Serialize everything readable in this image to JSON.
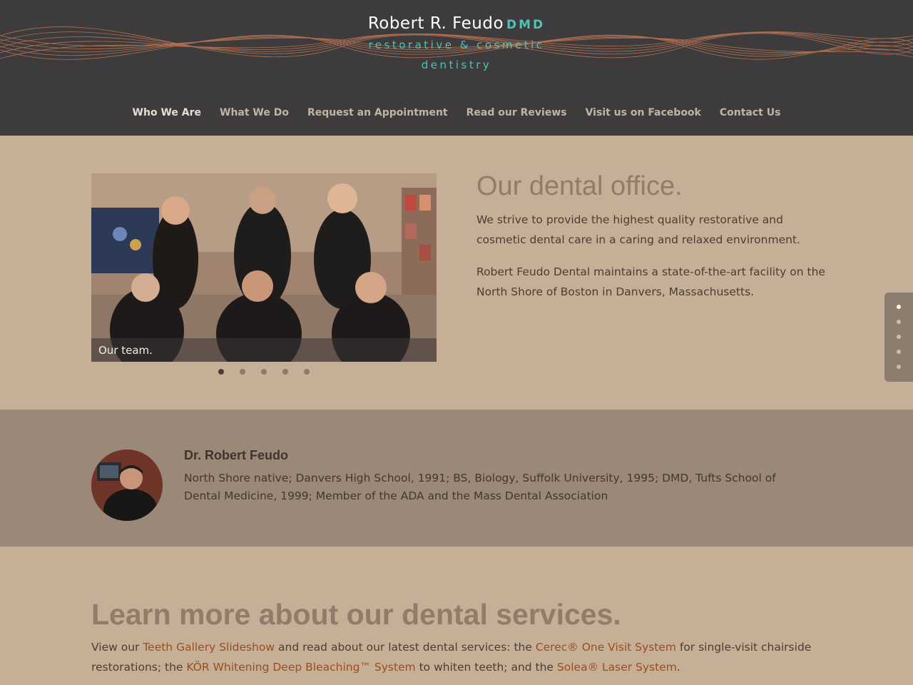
{
  "brand": {
    "name": "Robert R. Feudo",
    "suffix": "DMD",
    "tagline1": "restorative & cosmetic",
    "tagline2": "dentistry",
    "accent": "#4fc3b6",
    "header_bg": "#3d3b3b"
  },
  "nav": {
    "items": [
      {
        "label": "Who We Are",
        "active": true
      },
      {
        "label": "What We Do"
      },
      {
        "label": "Request an Appointment"
      },
      {
        "label": "Read our Reviews"
      },
      {
        "label": "Visit us on Facebook"
      },
      {
        "label": "Contact Us"
      }
    ]
  },
  "slider": {
    "caption": "Our team.",
    "slide_count": 5,
    "active_index": 0
  },
  "office": {
    "title": "Our dental office.",
    "p1": "We strive to provide the highest quality restorative and cosmetic dental care in a caring and relaxed environment.",
    "p2": "Robert Feudo Dental maintains a state-of-the-art facility on the North Shore of Boston in Danvers, Massachusetts."
  },
  "side_nav": {
    "count": 5,
    "active_index": 0
  },
  "doctor": {
    "name": "Dr. Robert Feudo",
    "bio": "North Shore native; Danvers High School, 1991; BS, Biology, Suffolk University, 1995; DMD, Tufts School of Dental Medicine, 1999; Member of the ADA and the Mass Dental Association"
  },
  "services": {
    "title": "Learn more about our dental services.",
    "t1": "View our ",
    "link1": "Teeth Gallery Slideshow",
    "t2": " and read about our latest dental services: the ",
    "link2": "Cerec® One Visit System",
    "t3": " for single-visit chairside restorations; the ",
    "link3": "KÖR Whitening Deep Bleaching™ System",
    "t4": " to whiten teeth; and the ",
    "link4": "Solea® Laser System",
    "t5": "."
  }
}
